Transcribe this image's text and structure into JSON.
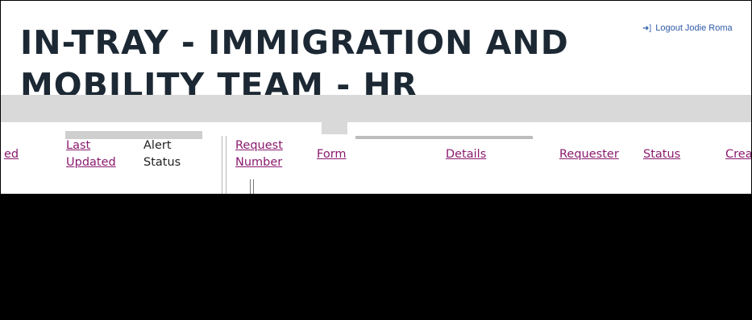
{
  "header": {
    "title": "IN-TRAY - IMMIGRATION AND MOBILITY TEAM - HR",
    "logout_label": "Logout Jodie Roma"
  },
  "icons": {
    "logout": "sign-out-icon"
  },
  "colors": {
    "title": "#1c2833",
    "link": "#8a1a6e",
    "logout_link": "#2d59a6",
    "band": "#d9d9d9"
  },
  "left_table": {
    "headers": [
      {
        "label": "ed"
      },
      {
        "label": "Last Updated"
      },
      {
        "label": "Alert Status"
      }
    ]
  },
  "right_table": {
    "headers": [
      {
        "label": "Request Number"
      },
      {
        "label": "Form"
      },
      {
        "label": "Details"
      },
      {
        "label": "Requester"
      },
      {
        "label": "Status"
      },
      {
        "label": "Crea"
      }
    ]
  }
}
